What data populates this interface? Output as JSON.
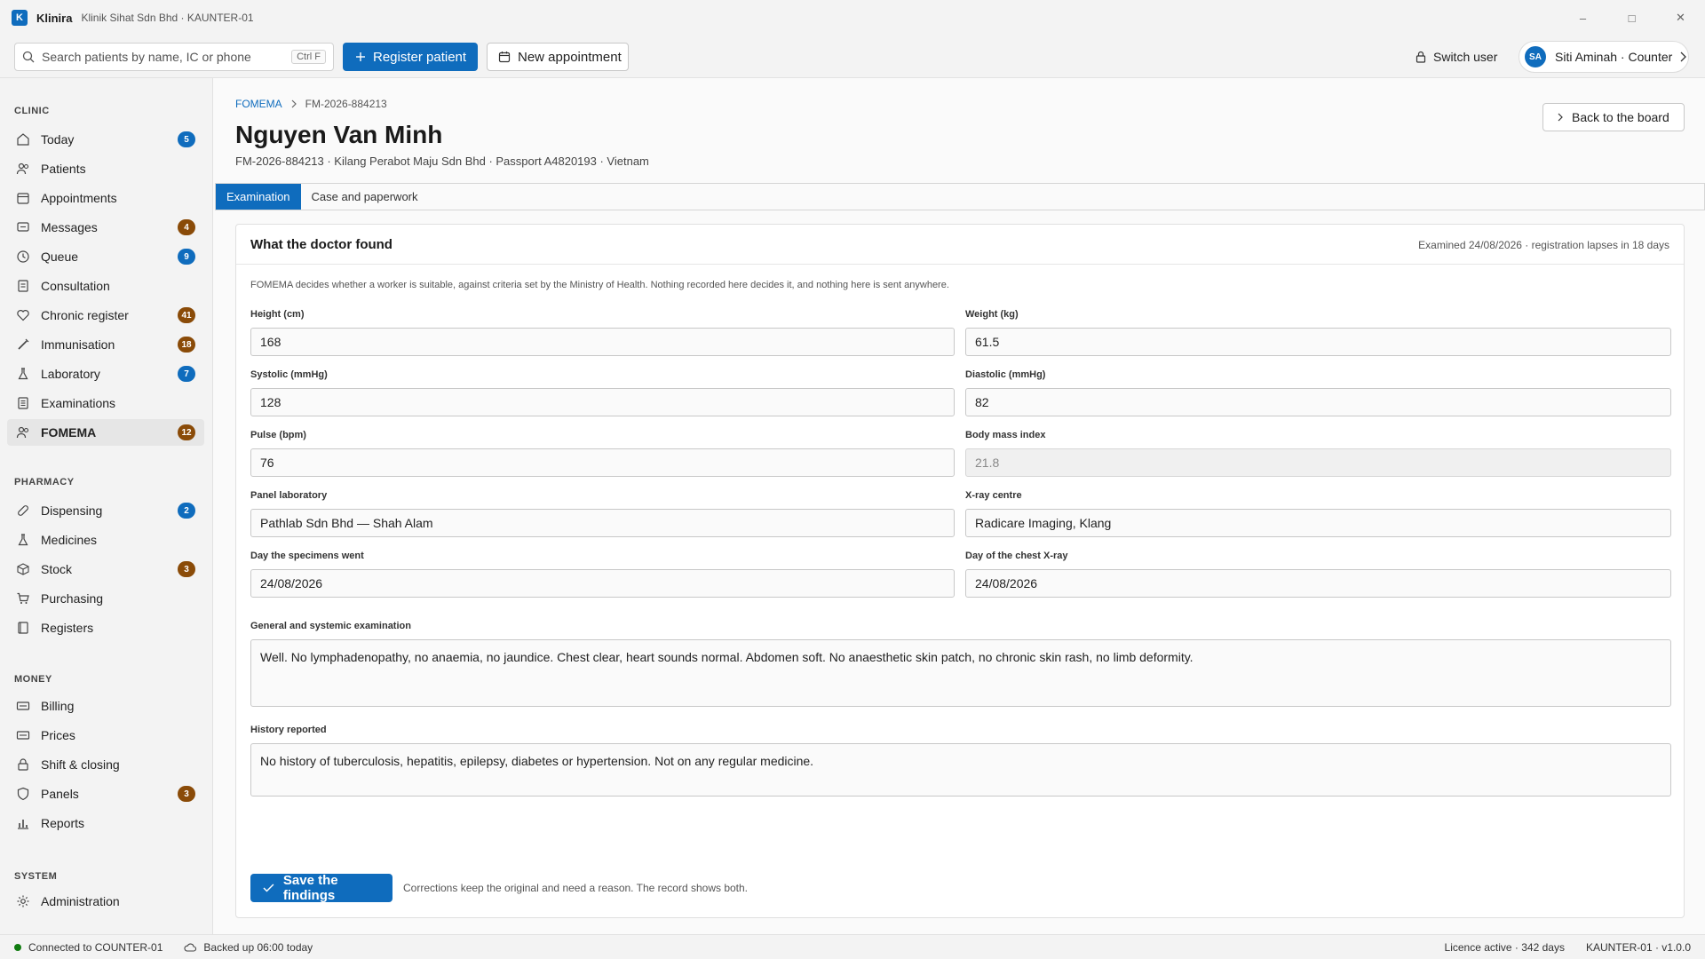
{
  "app": {
    "logo_letter": "K",
    "name": "Klinira",
    "subtitle": "Klinik Sihat Sdn Bhd · KAUNTER-01",
    "window_controls": {
      "minimize": "–",
      "maximize": "□",
      "close": "✕"
    }
  },
  "toolbar": {
    "search_placeholder": "Search patients by name, IC or phone",
    "search_shortcut": "Ctrl F",
    "register_label": "Register patient",
    "new_appointment_label": "New appointment",
    "switch_user_label": "Switch user",
    "user_initials": "SA",
    "user_name": "Siti Aminah · Counter"
  },
  "sidebar": {
    "sections": [
      {
        "title": "CLINIC"
      },
      {
        "title": "PHARMACY"
      },
      {
        "title": "MONEY"
      },
      {
        "title": "SYSTEM"
      }
    ],
    "items": [
      {
        "label": "Today",
        "icon": "home-icon",
        "badge": "5",
        "badge_color": "#0f6cbd"
      },
      {
        "label": "Patients",
        "icon": "people-icon",
        "badge": ""
      },
      {
        "label": "Appointments",
        "icon": "calendar-icon",
        "badge": ""
      },
      {
        "label": "Messages",
        "icon": "chat-icon",
        "badge": "4",
        "badge_color": "#8a4b08"
      },
      {
        "label": "Queue",
        "icon": "clock-icon",
        "badge": "9",
        "badge_color": "#0f6cbd"
      },
      {
        "label": "Consultation",
        "icon": "clipboard-icon",
        "badge": ""
      },
      {
        "label": "Chronic register",
        "icon": "heart-icon",
        "badge": "41",
        "badge_color": "#8a4b08"
      },
      {
        "label": "Immunisation",
        "icon": "syringe-icon",
        "badge": "18",
        "badge_color": "#8a4b08"
      },
      {
        "label": "Laboratory",
        "icon": "flask-icon",
        "badge": "7",
        "badge_color": "#0f6cbd"
      },
      {
        "label": "Examinations",
        "icon": "clipboard-list-icon",
        "badge": ""
      },
      {
        "label": "FOMEMA",
        "icon": "people-icon",
        "badge": "12",
        "badge_color": "#8a4b08",
        "active": true
      },
      {
        "label": "Dispensing",
        "icon": "pill-icon",
        "badge": "2",
        "badge_color": "#0f6cbd"
      },
      {
        "label": "Medicines",
        "icon": "flask-icon",
        "badge": ""
      },
      {
        "label": "Stock",
        "icon": "box-icon",
        "badge": "3",
        "badge_color": "#8a4b08"
      },
      {
        "label": "Purchasing",
        "icon": "cart-icon",
        "badge": ""
      },
      {
        "label": "Registers",
        "icon": "book-icon",
        "badge": ""
      },
      {
        "label": "Billing",
        "icon": "money-icon",
        "badge": ""
      },
      {
        "label": "Prices",
        "icon": "money-icon",
        "badge": ""
      },
      {
        "label": "Shift & closing",
        "icon": "lock-icon",
        "badge": ""
      },
      {
        "label": "Panels",
        "icon": "shield-icon",
        "badge": "3",
        "badge_color": "#8a4b08"
      },
      {
        "label": "Reports",
        "icon": "bar-chart-icon",
        "badge": ""
      },
      {
        "label": "Administration",
        "icon": "gear-icon",
        "badge": ""
      }
    ]
  },
  "breadcrumb": {
    "parent": "FOMEMA",
    "current": "FM-2026-884213"
  },
  "patient": {
    "name": "Nguyen Van Minh",
    "summary": "FM-2026-884213 · Kilang Perabot Maju Sdn Bhd · Passport A4820193 · Vietnam"
  },
  "back_label": "Back to the board",
  "tabs": [
    {
      "label": "Examination",
      "active": true
    },
    {
      "label": "Case and paperwork",
      "active": false
    }
  ],
  "card": {
    "title": "What the doctor found",
    "meta": "Examined 24/08/2026 · registration lapses in 18 days",
    "note": "FOMEMA decides whether a worker is suitable, against criteria set by the Ministry of Health. Nothing recorded here decides it, and nothing here is sent anywhere."
  },
  "fields": {
    "height": {
      "label": "Height (cm)",
      "value": "168"
    },
    "weight": {
      "label": "Weight (kg)",
      "value": "61.5"
    },
    "systolic": {
      "label": "Systolic (mmHg)",
      "value": "128"
    },
    "diastolic": {
      "label": "Diastolic (mmHg)",
      "value": "82"
    },
    "pulse": {
      "label": "Pulse (bpm)",
      "value": "76"
    },
    "bmi": {
      "label": "Body mass index",
      "value": "21.8"
    },
    "panel_lab": {
      "label": "Panel laboratory",
      "value": "Pathlab Sdn Bhd — Shah Alam"
    },
    "xray_centre": {
      "label": "X-ray centre",
      "value": "Radicare Imaging, Klang"
    },
    "specimen_day": {
      "label": "Day the specimens went",
      "value": "24/08/2026"
    },
    "xray_day": {
      "label": "Day of the chest X-ray",
      "value": "24/08/2026"
    },
    "general_exam": {
      "label": "General and systemic examination",
      "value": "Well. No lymphadenopathy, no anaemia, no jaundice. Chest clear, heart sounds normal. Abdomen soft. No anaesthetic skin patch, no chronic skin rash, no limb deformity."
    },
    "history": {
      "label": "History reported",
      "value": "No history of tuberculosis, hepatitis, epilepsy, diabetes or hypertension. Not on any regular medicine."
    }
  },
  "save": {
    "label": "Save the findings",
    "note": "Corrections keep the original and need a reason. The record shows both."
  },
  "status": {
    "connection": "Connected to COUNTER-01",
    "backup": "Backed up 06:00 today",
    "licence": "Licence active · 342 days",
    "version": "KAUNTER-01 · v1.0.0"
  },
  "colors": {
    "accent": "#0f6cbd",
    "badge_amber": "#8a4b08",
    "online": "#107c10"
  }
}
